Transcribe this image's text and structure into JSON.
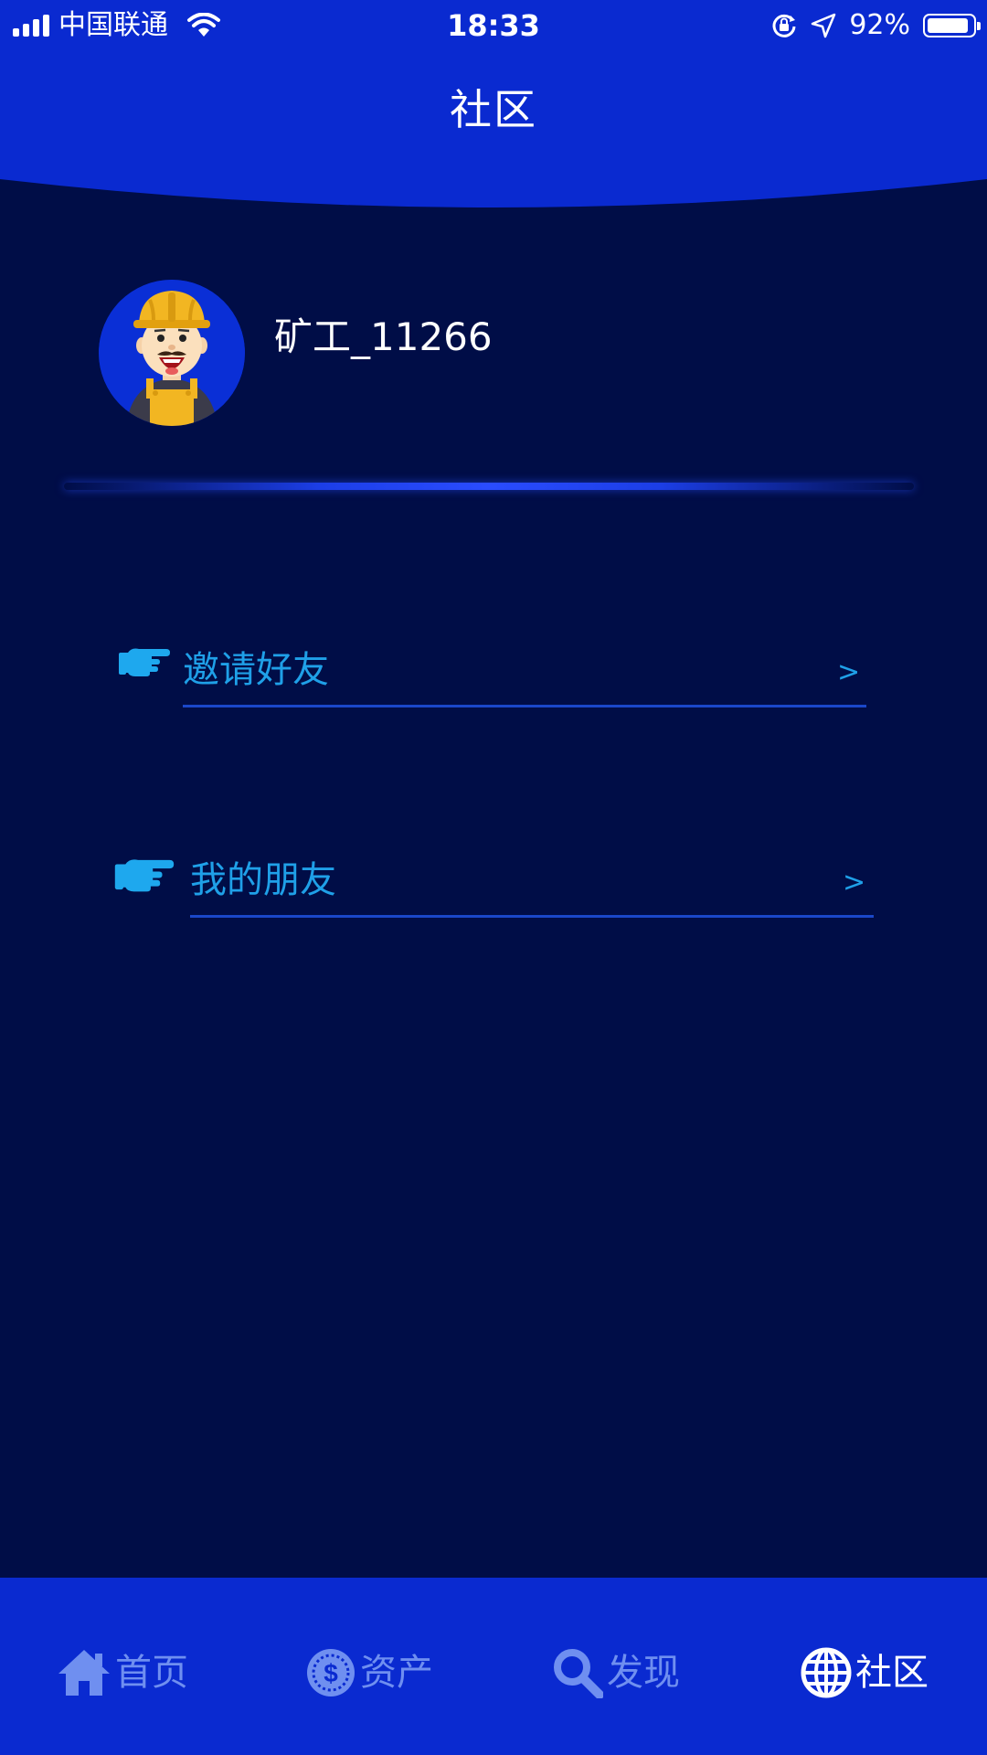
{
  "status_bar": {
    "carrier": "中国联通",
    "time": "18:33",
    "battery_percent": "92%",
    "battery_level": 0.92
  },
  "header": {
    "title": "社区"
  },
  "profile": {
    "username": "矿工_11266"
  },
  "menu": [
    {
      "label": "邀请好友",
      "arrow": ">"
    },
    {
      "label": "我的朋友",
      "arrow": ">"
    }
  ],
  "tabbar": {
    "active_index": 3,
    "tabs": [
      {
        "label": "首页",
        "icon": "home-icon"
      },
      {
        "label": "资产",
        "icon": "coin-icon"
      },
      {
        "label": "发现",
        "icon": "search-icon"
      },
      {
        "label": "社区",
        "icon": "globe-icon"
      }
    ]
  },
  "colors": {
    "background": "#000d47",
    "header_blue": "#0a2ad0",
    "accent_cyan": "#1fa0e8",
    "tab_inactive": "#6f8ff0",
    "tab_active": "#ffffff"
  }
}
